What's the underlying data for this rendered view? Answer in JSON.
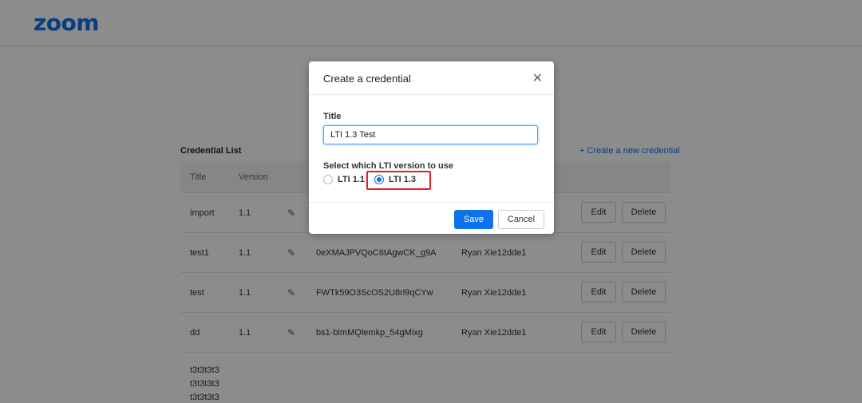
{
  "header": {
    "logo": "zoom"
  },
  "list": {
    "title": "Credential List",
    "create_link": "+ Create a new credential",
    "columns": {
      "title": "Title",
      "version": "Version"
    },
    "rows": [
      {
        "title": "import",
        "version": "1.1",
        "key": "",
        "owner": "",
        "edit": "Edit",
        "delete": "Delete"
      },
      {
        "title": "test1",
        "version": "1.1",
        "key": "0eXMAJPVQoC6tAgwCK_g9A",
        "owner": "Ryan Xie12dde1",
        "edit": "Edit",
        "delete": "Delete"
      },
      {
        "title": "test",
        "version": "1.1",
        "key": "FWTk59O3ScOS2U8rl9qCYw",
        "owner": "Ryan Xie12dde1",
        "edit": "Edit",
        "delete": "Delete"
      },
      {
        "title": "dd",
        "version": "1.1",
        "key": "bs1-blmMQlemkp_54gMixg",
        "owner": "Ryan Xie12dde1",
        "edit": "Edit",
        "delete": "Delete"
      }
    ],
    "partial_row_lines": [
      "t3t3t3t3",
      "t3t3t3t3",
      "t3t3t3t3"
    ]
  },
  "modal": {
    "title": "Create a credential",
    "title_label": "Title",
    "title_value": "LTI 1.3 Test",
    "version_label": "Select which LTI version to use",
    "options": [
      {
        "label": "LTI 1.1",
        "checked": false
      },
      {
        "label": "LTI 1.3",
        "checked": true
      }
    ],
    "save": "Save",
    "cancel": "Cancel"
  },
  "colors": {
    "accent": "#0e72ed",
    "highlight": "#e02020"
  }
}
